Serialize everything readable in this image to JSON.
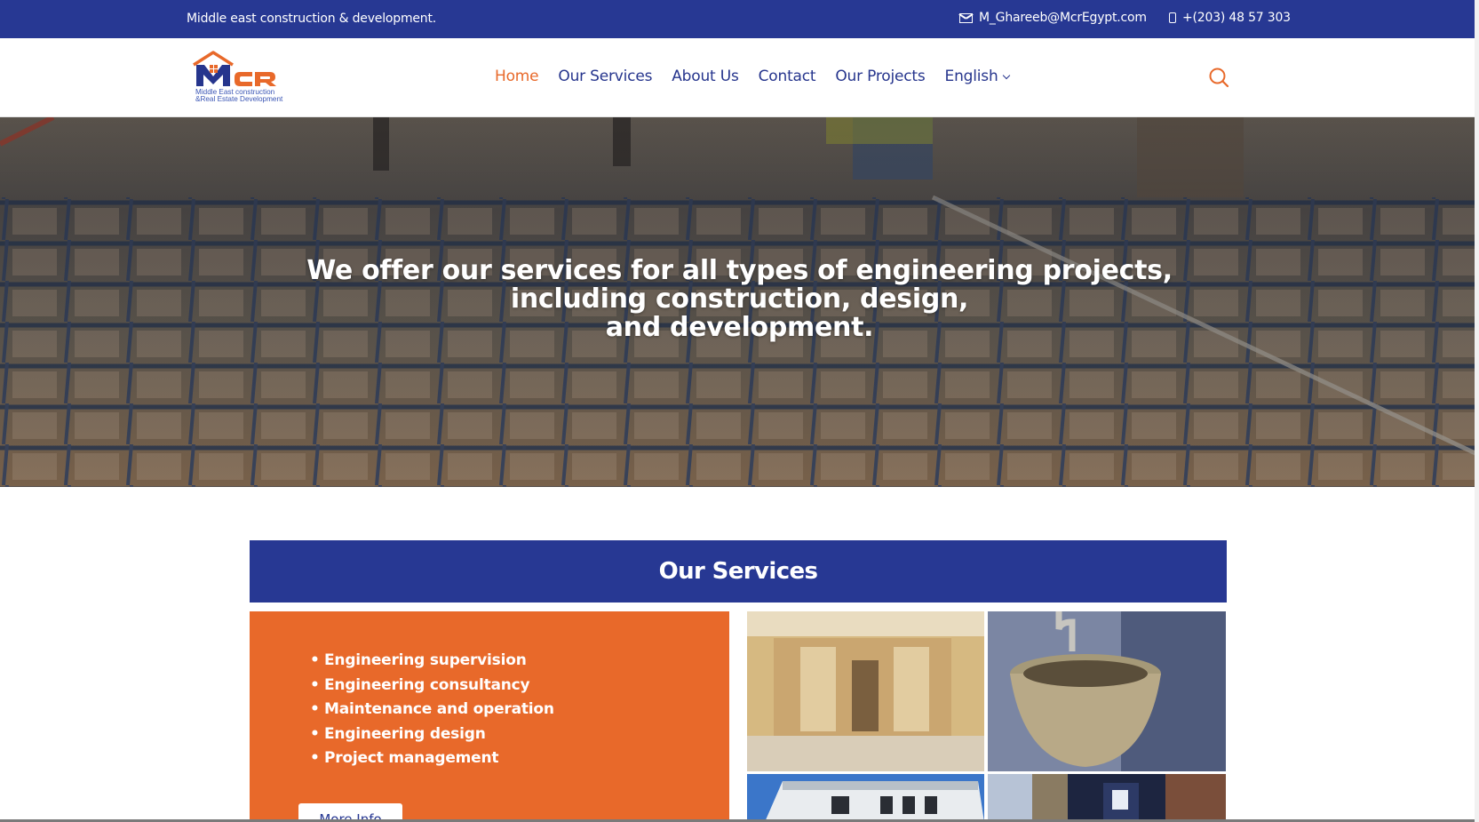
{
  "topbar": {
    "tagline": "Middle east construction & development.",
    "email": "M_Ghareeb@McrEgypt.com",
    "phone": "+(203) 48 57 303"
  },
  "logo": {
    "letters": "MCR",
    "subtitle_line1": "Middle East construction",
    "subtitle_line2": "&Real Estate Development"
  },
  "nav": {
    "items": [
      {
        "label": "Home",
        "active": true
      },
      {
        "label": "Our Services"
      },
      {
        "label": "About Us"
      },
      {
        "label": "Contact"
      },
      {
        "label": "Our Projects"
      },
      {
        "label": "English"
      }
    ]
  },
  "hero": {
    "line1": "We offer our services for all types of engineering projects,",
    "line2": "including construction, design,",
    "line3": "and development."
  },
  "services": {
    "title": "Our Services",
    "items": [
      "Engineering supervision",
      "Engineering consultancy",
      "Maintenance and operation",
      "Engineering design",
      "Project management"
    ],
    "more_button": "More Info"
  },
  "colors": {
    "brand_blue": "#273893",
    "brand_orange": "#e8692a"
  },
  "icons": [
    "mail-icon",
    "phone-icon",
    "search-icon",
    "chevron-down-icon"
  ]
}
